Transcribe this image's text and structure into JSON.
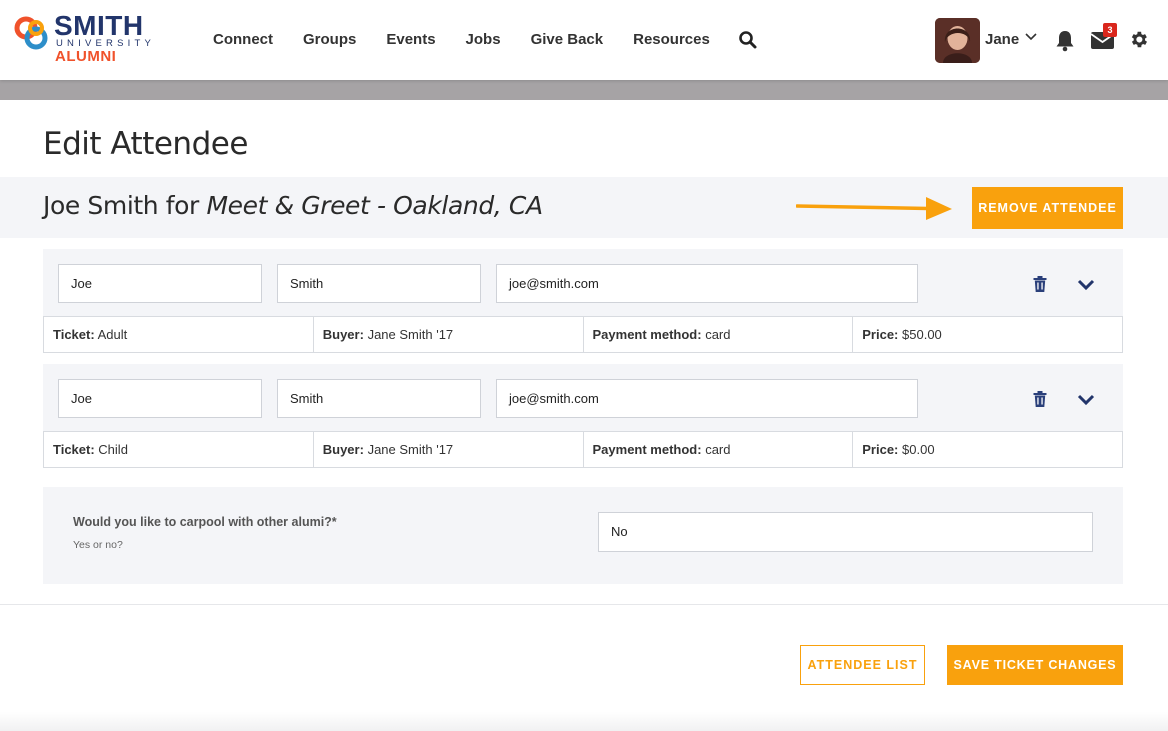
{
  "header": {
    "logo": {
      "word": "SMITH",
      "sub": "UNIVERSITY",
      "alumni": "ALUMNI"
    },
    "nav": [
      "Connect",
      "Groups",
      "Events",
      "Jobs",
      "Give Back",
      "Resources"
    ],
    "user_name": "Jane",
    "mail_count": "3"
  },
  "page": {
    "title": "Edit Attendee",
    "attendee_name": "Joe Smith",
    "for_word": "for",
    "event_name": "Meet & Greet - Oakland, CA",
    "remove_label": "REMOVE ATTENDEE"
  },
  "attendees": [
    {
      "first": "Joe",
      "last": "Smith",
      "email": "joe@smith.com",
      "ticket_label": "Ticket:",
      "ticket": "Adult",
      "buyer_label": "Buyer:",
      "buyer": "Jane Smith '17",
      "payment_label": "Payment method:",
      "payment": "card",
      "price_label": "Price:",
      "price": "$50.00"
    },
    {
      "first": "Joe",
      "last": "Smith",
      "email": "joe@smith.com",
      "ticket_label": "Ticket:",
      "ticket": "Child",
      "buyer_label": "Buyer:",
      "buyer": "Jane Smith '17",
      "payment_label": "Payment method:",
      "payment": "card",
      "price_label": "Price:",
      "price": "$0.00"
    }
  ],
  "carpool": {
    "question": "Would you like to carpool with other alumi?*",
    "hint": "Yes or no?",
    "answer": "No"
  },
  "footer": {
    "list_label": "ATTENDEE LIST",
    "save_label": "SAVE TICKET CHANGES"
  },
  "colors": {
    "accent": "#f9a10d",
    "brand": "#22356b",
    "brand_alt": "#f0522b",
    "badge": "#d9261c"
  }
}
